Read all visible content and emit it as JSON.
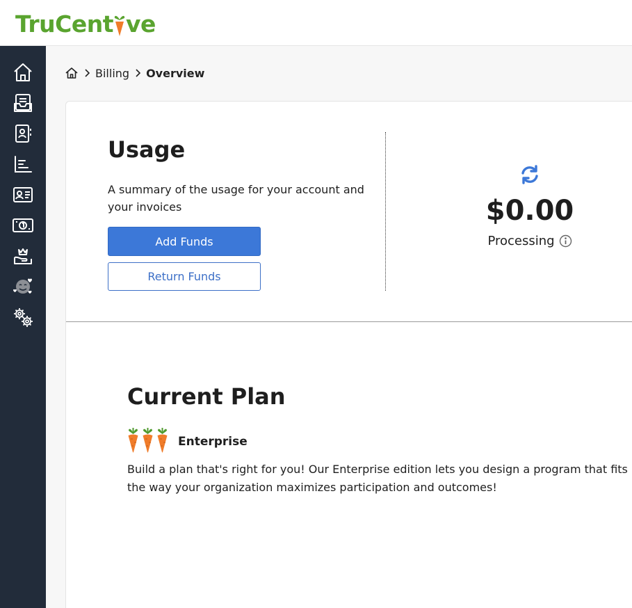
{
  "header": {
    "logo_prefix": "TruCent",
    "logo_suffix": "ve",
    "brand_color": "#5aa42f",
    "carrot_color": "#f07c2a"
  },
  "sidebar": {
    "background": "#222c3a",
    "items": [
      {
        "icon": "home-icon"
      },
      {
        "icon": "inbox-icon"
      },
      {
        "icon": "contacts-book-icon"
      },
      {
        "icon": "bar-chart-icon"
      },
      {
        "icon": "id-card-icon"
      },
      {
        "icon": "money-bill-icon"
      },
      {
        "icon": "crown-hand-icon"
      },
      {
        "icon": "happy-face-hearts-icon"
      },
      {
        "icon": "gears-icon"
      }
    ]
  },
  "breadcrumb": {
    "items": [
      "Billing",
      "Overview"
    ]
  },
  "usage": {
    "title": "Usage",
    "description": "A summary of the usage for your account and your invoices",
    "add_funds_label": "Add Funds",
    "return_funds_label": "Return Funds",
    "amount": "$0.00",
    "status": "Processing",
    "accent_color": "#3c78d8"
  },
  "plan": {
    "title": "Current Plan",
    "name": "Enterprise",
    "carrot_count": 3,
    "description": "Build a plan that's right for you! Our Enterprise edition lets you design a program that fits the way your organization maximizes participation and outcomes!"
  }
}
